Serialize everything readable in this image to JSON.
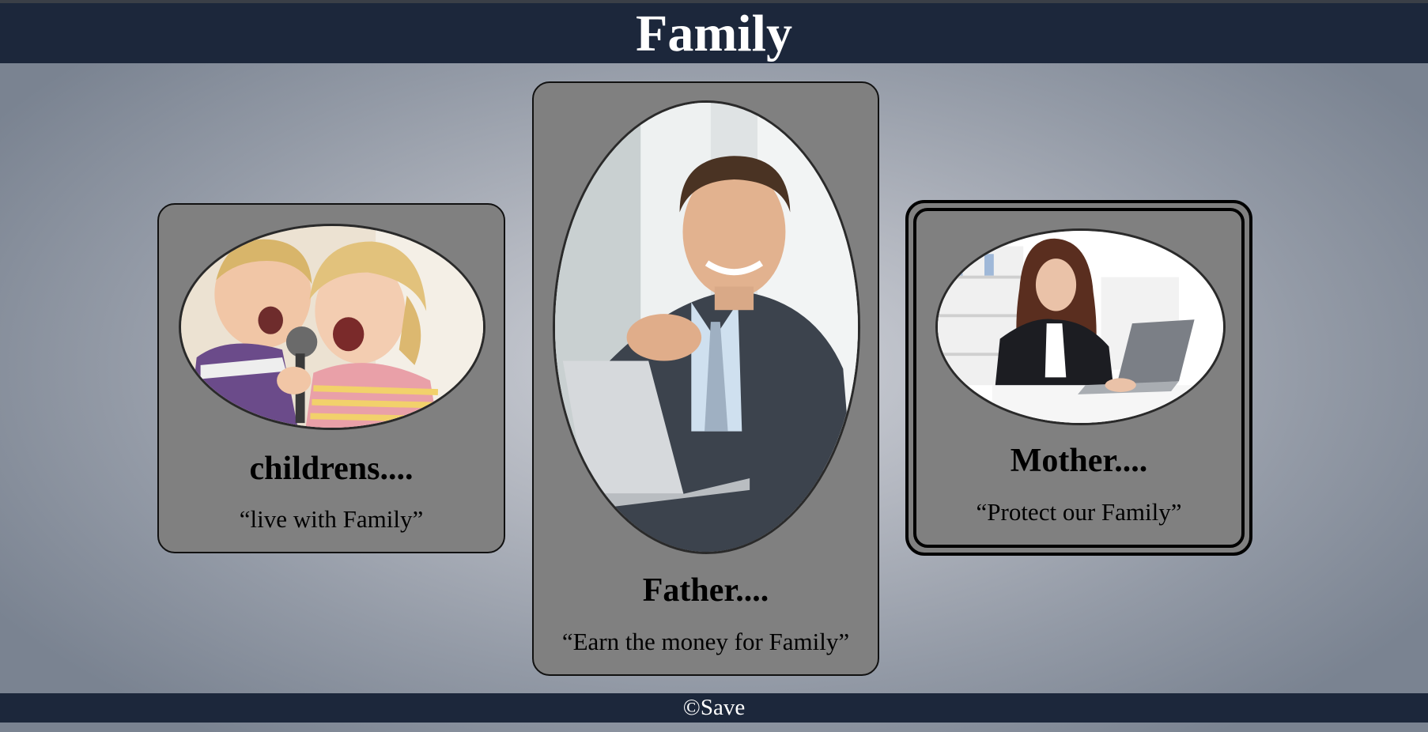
{
  "header": {
    "title": "Family"
  },
  "cards": {
    "children": {
      "title": "childrens....",
      "quote": "“live with Family”"
    },
    "father": {
      "title": "Father....",
      "quote": "“Earn the money for Family”"
    },
    "mother": {
      "title": "Mother....",
      "quote": "“Protect our Family”"
    }
  },
  "footer": {
    "text": "©Save"
  },
  "colors": {
    "header_bg": "#1c273b",
    "card_bg": "#808080",
    "page_bg": "#b3b7c0"
  }
}
